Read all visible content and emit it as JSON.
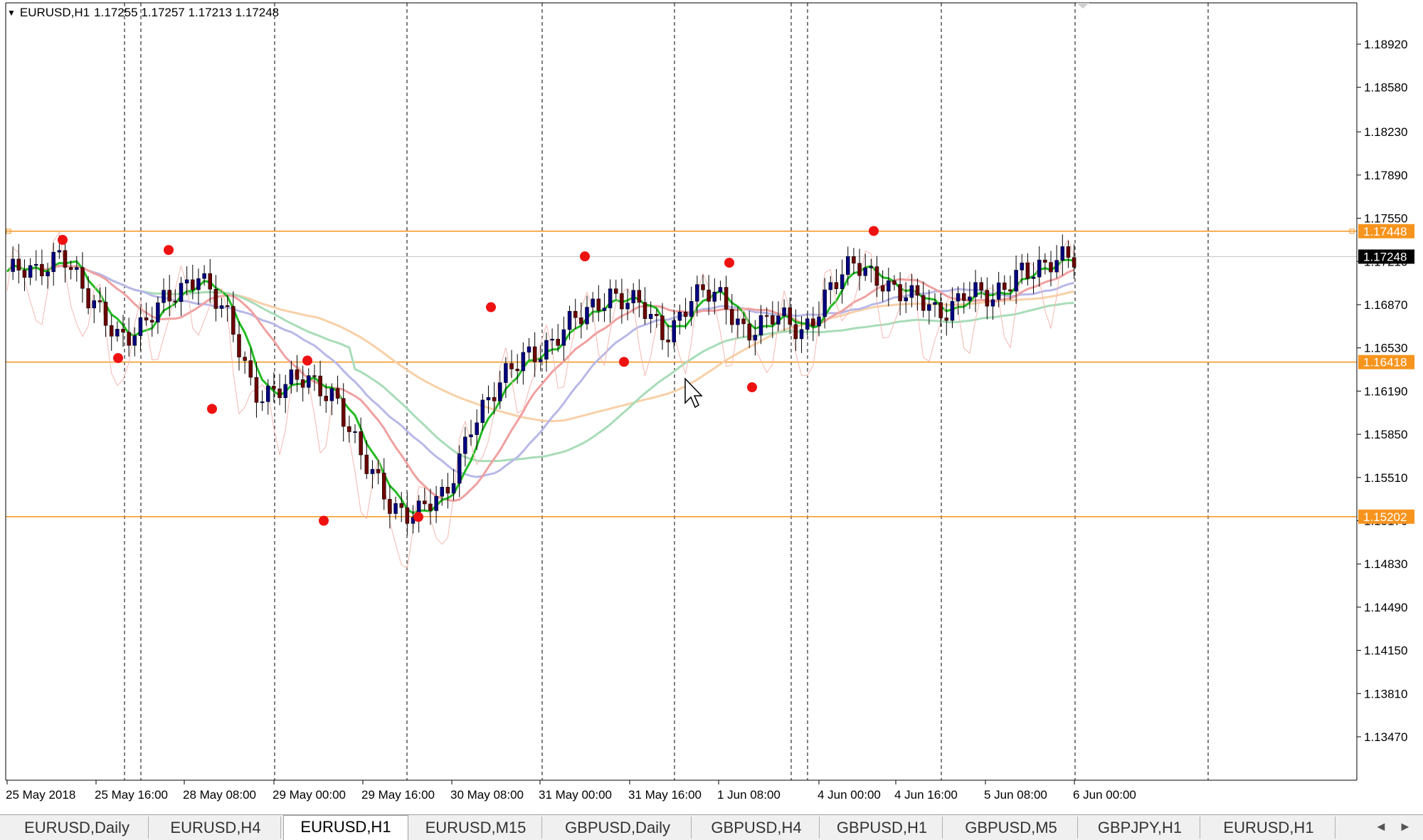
{
  "header": {
    "symbol": "EURUSD,H1",
    "ohlc": "1.17255 1.17257 1.17213 1.17248"
  },
  "price_axis": {
    "ticks": [
      "1.18920",
      "1.18580",
      "1.18230",
      "1.17890",
      "1.17550",
      "1.17210",
      "1.16870",
      "1.16530",
      "1.16190",
      "1.15850",
      "1.15510",
      "1.15170",
      "1.14830",
      "1.14490",
      "1.14150",
      "1.13810",
      "1.13470"
    ],
    "tick_values": [
      1.1892,
      1.1858,
      1.1823,
      1.1789,
      1.1755,
      1.1721,
      1.1687,
      1.1653,
      1.1619,
      1.1585,
      1.1551,
      1.1517,
      1.1483,
      1.1449,
      1.1415,
      1.1381,
      1.1347
    ]
  },
  "time_axis": {
    "labels": [
      "25 May 2018",
      "25 May 16:00",
      "28 May 08:00",
      "29 May 00:00",
      "29 May 16:00",
      "30 May 08:00",
      "31 May 00:00",
      "31 May 16:00",
      "1 Jun 08:00",
      "4 Jun 00:00",
      "4 Jun 16:00",
      "5 Jun 08:00",
      "6 Jun 00:00"
    ]
  },
  "levels": [
    {
      "label": "1.17448",
      "value": 1.17448,
      "color": "#f7941d"
    },
    {
      "label": "1.16418",
      "value": 1.16418,
      "color": "#f7941d"
    },
    {
      "label": "1.15202",
      "value": 1.15202,
      "color": "#f7941d"
    }
  ],
  "current_price": {
    "label": "1.17248",
    "value": 1.17248
  },
  "tabs": [
    {
      "label": "EURUSD,Daily",
      "active": false
    },
    {
      "label": "EURUSD,H4",
      "active": false
    },
    {
      "label": "EURUSD,H1",
      "active": true
    },
    {
      "label": "EURUSD,M15",
      "active": false
    },
    {
      "label": "GBPUSD,Daily",
      "active": false
    },
    {
      "label": "GBPUSD,H4",
      "active": false
    },
    {
      "label": "GBPUSD,H1",
      "active": false
    },
    {
      "label": "GBPUSD,M5",
      "active": false
    },
    {
      "label": "GBPJPY,H1",
      "active": false
    },
    {
      "label": "EURUSD,H1",
      "active": false
    }
  ],
  "nav": {
    "left": "◄",
    "right": "►"
  },
  "colors": {
    "bull": "#000080",
    "bear": "#6b0000",
    "ma_fast": "#22bb22",
    "ma_red": "#f0a0a0",
    "ma_blue": "#b8b8e8",
    "ma_peach": "#f8d0a8",
    "ma_mint": "#a8dcb8",
    "swing": "#ee1111",
    "level": "#f7941d"
  },
  "chart_data": {
    "type": "candlestick",
    "series": [
      {
        "name": "EURUSD,H1 close",
        "values": [
          1.1713,
          1.1708,
          1.1735,
          1.1685,
          1.1665,
          1.1672,
          1.169,
          1.1717,
          1.1675,
          1.162,
          1.1623,
          1.1624,
          1.162,
          1.156,
          1.1531,
          1.1525,
          1.1531,
          1.16,
          1.162,
          1.165,
          1.166,
          1.1675,
          1.17,
          1.1685,
          1.1663,
          1.1695,
          1.169,
          1.167,
          1.1675,
          1.1665,
          1.17,
          1.1715,
          1.171,
          1.169,
          1.168,
          1.17,
          1.1685,
          1.172,
          1.1713,
          1.1725
        ]
      }
    ],
    "swing_points": [
      1.1738,
      1.1645,
      1.173,
      1.1605,
      1.1643,
      1.1517,
      1.152,
      1.1685,
      1.1725,
      1.1642,
      1.172,
      1.1622,
      1.1745
    ],
    "ylim": [
      1.1347,
      1.191
    ]
  }
}
